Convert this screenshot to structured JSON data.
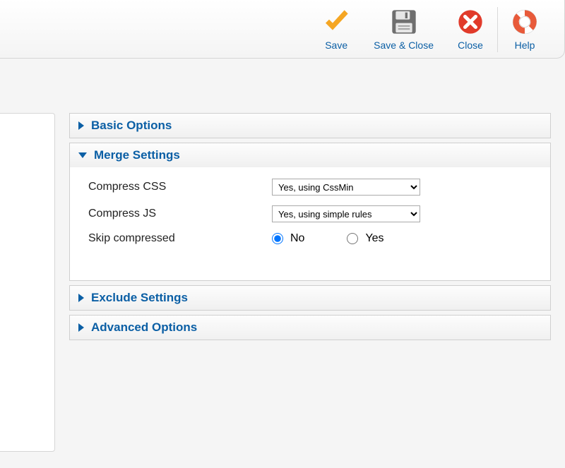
{
  "toolbar": {
    "save": "Save",
    "saveclose": "Save & Close",
    "close": "Close",
    "help": "Help"
  },
  "panels": {
    "basic": {
      "title": "Basic Options"
    },
    "merge": {
      "title": "Merge Settings",
      "compress_css_label": "Compress CSS",
      "compress_css_value": "Yes, using CssMin",
      "compress_js_label": "Compress JS",
      "compress_js_value": "Yes, using simple rules",
      "skip_label": "Skip compressed",
      "skip_no": "No",
      "skip_yes": "Yes",
      "skip_selected": "no"
    },
    "exclude": {
      "title": "Exclude Settings"
    },
    "advanced": {
      "title": "Advanced Options"
    }
  }
}
